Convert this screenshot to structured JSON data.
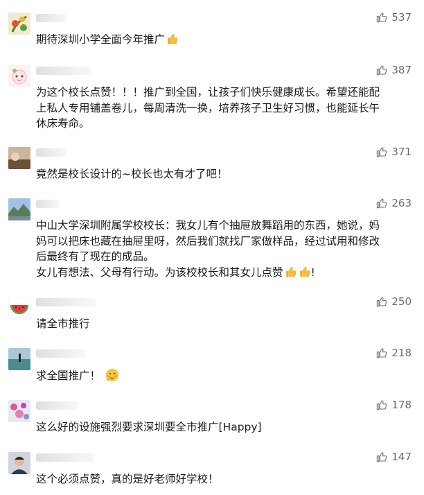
{
  "comments": [
    {
      "likes": "537",
      "lines": [
        "期待深圳小学全面今年推广"
      ],
      "emoji": "thumbs-up",
      "avatar": "plant"
    },
    {
      "likes": "387",
      "lines": [
        "为这个校长点赞！！！推广到全国，让孩子们快乐健康成长。希望还能配",
        "上私人专用铺盖卷儿，每周清洗一换，培养孩子卫生好习惯，也能延长午",
        "休床寿命。"
      ],
      "avatar": "cartoon"
    },
    {
      "likes": "371",
      "lines": [
        "竟然是校长设计的~校长也太有才了吧！"
      ],
      "avatar": "landscape"
    },
    {
      "likes": "263",
      "lines": [
        "中山大学深圳附属学校校长：我女儿有个抽屉放舞蹈用的东西，她说，妈",
        "妈可以把床也藏在抽屉里呀，然后我们就找厂家做样品，经过试用和修改",
        "后最终有了现在的成品。"
      ],
      "line_last": "女儿有想法、父母有行动。为该校校长和其女儿点赞",
      "line_last_suffix": "!",
      "avatar": "mountain"
    },
    {
      "likes": "250",
      "lines": [
        "请全市推行"
      ],
      "avatar": "watermelon"
    },
    {
      "likes": "218",
      "lines": [
        "求全国推广！"
      ],
      "emoji": "blush",
      "avatar": "beach"
    },
    {
      "likes": "178",
      "lines": [
        "这么好的设施强烈要求深圳要全市推广[Happy]"
      ],
      "avatar": "flowers"
    },
    {
      "likes": "147",
      "lines": [
        "这个必须点赞，真的是好老师好学校！"
      ],
      "avatar": "person"
    }
  ],
  "colors": {
    "text": "#1a1a1a",
    "likes": "#6b6b6b"
  },
  "icons": {
    "like": "thumbs-up-icon"
  }
}
